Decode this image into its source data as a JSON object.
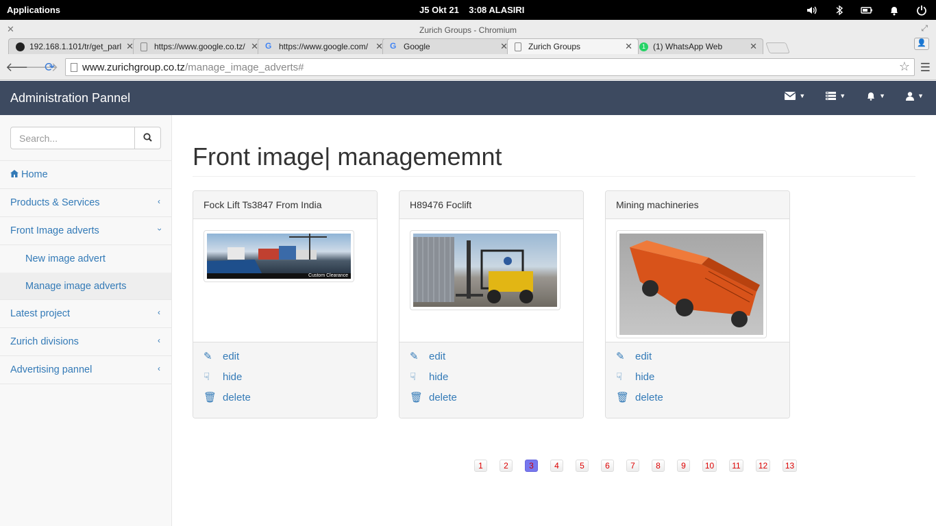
{
  "os": {
    "apps_label": "Applications",
    "clock": "J5 Okt 21    3:08 ALASIRI",
    "tray_icons": [
      "volume-icon",
      "bluetooth-icon",
      "battery-icon",
      "bell-icon",
      "power-icon"
    ]
  },
  "browser": {
    "window_title": "Zurich Groups - Chromium",
    "tabs": [
      {
        "label": "192.168.1.101/tr/get_parl",
        "active": false
      },
      {
        "label": "https://www.google.co.tz/",
        "active": false
      },
      {
        "label": "https://www.google.com/",
        "active": false
      },
      {
        "label": "Google",
        "active": false
      },
      {
        "label": "Zurich Groups",
        "active": true
      },
      {
        "label": "(1) WhatsApp Web",
        "active": false
      }
    ],
    "url_host": "www.zurichgroup.co.tz",
    "url_path": "/manage_image_adverts#"
  },
  "topnav": {
    "brand": "Administration Pannel",
    "tools": [
      "envelope-icon",
      "tasks-icon",
      "bell-icon",
      "user-icon"
    ]
  },
  "sidebar": {
    "search_placeholder": "Search...",
    "items": [
      {
        "label": "Home"
      },
      {
        "label": "Products & Services"
      },
      {
        "label": "Front Image adverts"
      },
      {
        "label": "New image advert"
      },
      {
        "label": "Manage image adverts"
      },
      {
        "label": "Latest project"
      },
      {
        "label": "Zurich divisions"
      },
      {
        "label": "Advertising pannel"
      }
    ]
  },
  "main": {
    "title": "Front image| managememnt",
    "cards": [
      {
        "title": "Fock Lift Ts3847 From India",
        "image_text": "Custom Clearance",
        "edit": "edit",
        "hide": "hide",
        "delete": "delete"
      },
      {
        "title": "H89476 Foclift",
        "edit": "edit",
        "hide": "hide",
        "delete": "delete"
      },
      {
        "title": "Mining machineries",
        "edit": "edit",
        "hide": "hide",
        "delete": "delete"
      }
    ],
    "pagination": [
      "1",
      "2",
      "3",
      "4",
      "5",
      "6",
      "7",
      "8",
      "9",
      "10",
      "11",
      "12",
      "13"
    ],
    "current_page": "3"
  }
}
